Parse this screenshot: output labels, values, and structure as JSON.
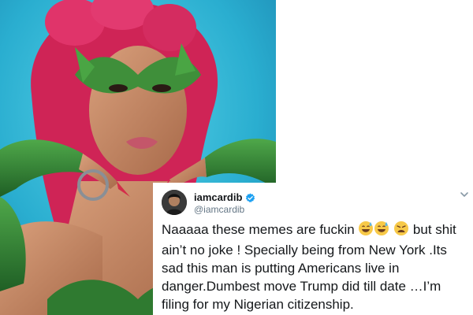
{
  "tweet": {
    "display_name": "iamcardib",
    "handle": "@iamcardib",
    "text_part1": "Naaaaa these memes are fuckin ",
    "text_part2": " but shit ain’t no joke ! Specially being from New York .Its sad this man is putting Americans live in danger.Dumbest move Trump did till date …I’m filing for my Nigerian citizenship.",
    "emojis": [
      "grinning-sweat-emoji",
      "grinning-sweat-emoji",
      "weary-face-emoji"
    ],
    "verified_icon": "verified-badge-icon",
    "menu_icon": "chevron-down-icon"
  },
  "colors": {
    "photo_background": "#2fb7d4",
    "hair": "#d8285a",
    "leaf_green": "#3f8f3a",
    "skin": "#c98e6a",
    "verified_blue": "#1da1f2",
    "text_primary": "#14171a",
    "text_secondary": "#657786"
  }
}
